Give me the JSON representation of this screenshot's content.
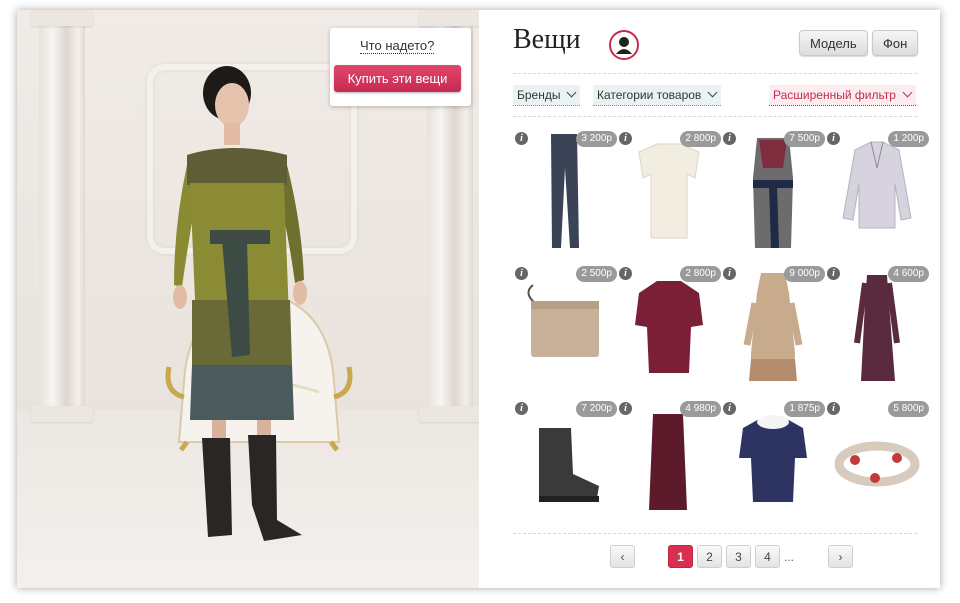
{
  "scene": {
    "what_link": "Что надето?",
    "buy_button": "Купить эти вещи"
  },
  "catalog": {
    "title": "Вещи",
    "toggles": [
      "Модель",
      "Фон"
    ],
    "filters": {
      "brands": "Бренды",
      "categories": "Категории товаров",
      "advanced": "Расширенный фильтр"
    },
    "items": [
      {
        "kind": "jeans",
        "price": "3 200р"
      },
      {
        "kind": "blouse",
        "price": "2 800р"
      },
      {
        "kind": "wrap-dress",
        "price": "7 500р"
      },
      {
        "kind": "moto-jacket",
        "price": "1 200р"
      },
      {
        "kind": "clutch",
        "price": "2 500р"
      },
      {
        "kind": "burgundy-top",
        "price": "2 800р"
      },
      {
        "kind": "knit-dress",
        "price": "9 000р"
      },
      {
        "kind": "plaid-dress",
        "price": "4 600р"
      },
      {
        "kind": "boot",
        "price": "7 200р"
      },
      {
        "kind": "maxi-skirt",
        "price": "4 980р"
      },
      {
        "kind": "collar-blouse",
        "price": "1 875р"
      },
      {
        "kind": "bracelet",
        "price": "5 800р"
      }
    ],
    "pager": {
      "prev": "‹",
      "pages": [
        "1",
        "2",
        "3",
        "4"
      ],
      "active": "1",
      "ellipsis": "...",
      "next": "›"
    }
  },
  "colors": {
    "accent": "#d9304f",
    "filter_bg": "#eaf3f4"
  }
}
